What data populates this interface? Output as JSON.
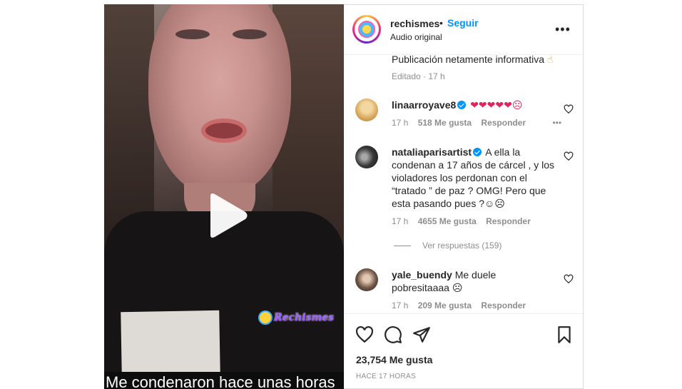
{
  "video": {
    "caption": "Me condenaron hace unas horas",
    "watermark": "Rechismes"
  },
  "header": {
    "username": "rechismes",
    "separator": "•",
    "follow_label": "Seguir",
    "audio_label": "Audio original",
    "more_label": "•••"
  },
  "post": {
    "caption_text": "Publicación netamente informativa",
    "edited": "Editado",
    "time": "17 h"
  },
  "comments": [
    {
      "username": "linaarroyave8",
      "verified": true,
      "text": "❤❤❤❤❤☹",
      "time": "17 h",
      "likes": "518 Me gusta",
      "reply": "Responder",
      "more": "•••"
    },
    {
      "username": "nataliaparisartist",
      "verified": true,
      "text": "A ella la condenan a 17 años de cárcel , y los violadores los perdonan con el “tratado ” de paz ? OMG! Pero que esta pasando pues ?☺☹",
      "time": "17 h",
      "likes": "4655 Me gusta",
      "reply": "Responder",
      "replies_label": "Ver respuestas (159)"
    },
    {
      "username": "yale_buendy",
      "verified": false,
      "text": "Me duele pobresitaaaa ☹",
      "time": "17 h",
      "likes": "209 Me gusta",
      "reply": "Responder"
    }
  ],
  "footer": {
    "likes": "23,754 Me gusta",
    "ago": "HACE 17 HORAS"
  },
  "icons": [
    "play-icon",
    "heart-icon",
    "comment-icon",
    "share-icon",
    "bookmark-icon",
    "more-icon",
    "verified-icon"
  ],
  "colors": {
    "accent": "#0095f6",
    "text": "#262626",
    "muted": "#8e8e8e"
  }
}
